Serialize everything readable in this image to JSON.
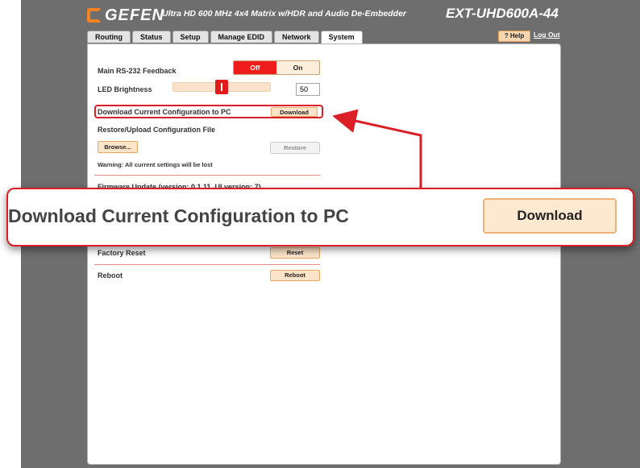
{
  "header": {
    "brand": "GEFEN",
    "subtitle": "Ultra HD 600 MHz 4x4 Matrix w/HDR and Audio De-Embedder",
    "model": "EXT-UHD600A-44"
  },
  "tabs": [
    {
      "label": "Routing"
    },
    {
      "label": "Status"
    },
    {
      "label": "Setup"
    },
    {
      "label": "Manage EDID"
    },
    {
      "label": "Network"
    },
    {
      "label": "System",
      "active": true
    }
  ],
  "help_label": "? Help",
  "logout_label": "Log Out",
  "system": {
    "rs232_label": "Main RS-232 Feedback",
    "rs232_options": [
      "Off",
      "On"
    ],
    "rs232_selected": "Off",
    "led_label": "LED Brightness",
    "led_value": "50",
    "led_level": 0.5,
    "download_label": "Download Current Configuration to PC",
    "download_button": "Download",
    "restore_label": "Restore/Upload Configuration File",
    "browse_button": "Browse...",
    "restore_button": "Restore",
    "warning": "Warning: All current settings will be lost",
    "firmware_label": "Firmware Update (version: 0.1.11, UI version: 7)",
    "factory_label": "Factory Reset",
    "reset_button": "Reset",
    "reboot_label": "Reboot",
    "reboot_button": "Reboot"
  },
  "callout": {
    "label": "Download Current Configuration to PC",
    "button": "Download"
  },
  "colors": {
    "frame": "#6e6e6e",
    "accent_red": "#ee1c1c",
    "button_fill": "#fce4c9",
    "highlight": "#dc1f27",
    "logo_orange": "#f58220"
  }
}
